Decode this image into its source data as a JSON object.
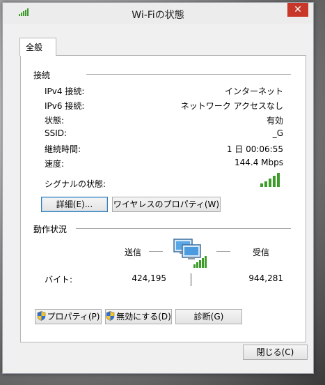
{
  "window": {
    "title": "Wi-Fiの状態",
    "close_glyph": "✕"
  },
  "tabs": [
    {
      "label": "全般"
    }
  ],
  "connection": {
    "heading": "接続",
    "rows": [
      {
        "label": "IPv4 接続:",
        "value": "インターネット"
      },
      {
        "label": "IPv6 接続:",
        "value": "ネットワーク アクセスなし"
      },
      {
        "label": "状態:",
        "value": "有効"
      },
      {
        "label": "SSID:",
        "value": "_G"
      },
      {
        "label": "継続時間:",
        "value": "1 日 00:06:55"
      },
      {
        "label": "速度:",
        "value": "144.4 Mbps"
      }
    ],
    "signal_label": "シグナルの状態:",
    "signal_bars": 5,
    "details_button": "詳細(E)...",
    "wireless_props_button": "ワイヤレスのプロパティ(W)"
  },
  "activity": {
    "heading": "動作状況",
    "sent_label": "送信",
    "received_label": "受信",
    "bytes_label": "バイト:",
    "bytes_sent": "424,195",
    "bytes_received": "944,281"
  },
  "actions": {
    "properties_button": "プロパティ(P)",
    "disable_button": "無効にする(D)",
    "diagnose_button": "診断(G)"
  },
  "footer": {
    "close_button": "閉じる(C)"
  },
  "colors": {
    "signal_green": "#3c9c2a",
    "close_red": "#c7372a",
    "focus_blue": "#3c7fb1"
  },
  "icons": [
    "wifi-signal-icon",
    "close-icon",
    "network-computers-icon",
    "uac-shield-icon"
  ]
}
